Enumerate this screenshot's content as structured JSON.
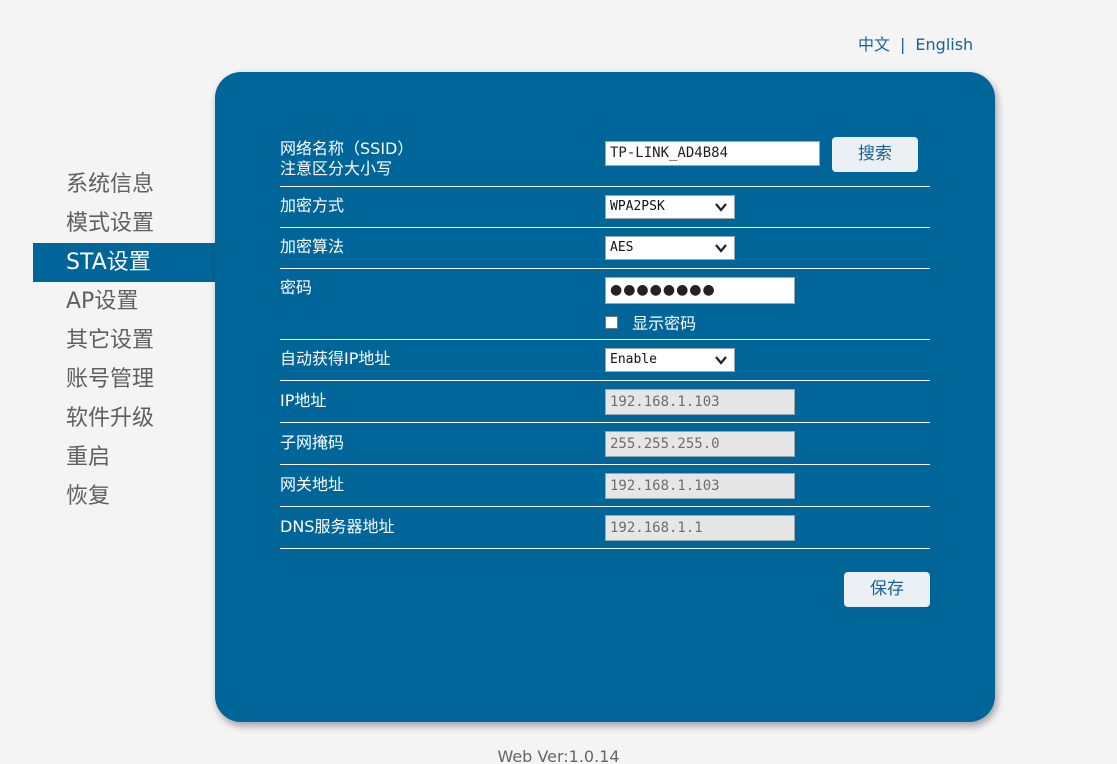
{
  "lang": {
    "zh": "中文",
    "sep": "|",
    "en": "English"
  },
  "sidebar": {
    "items": [
      {
        "label": "系统信息"
      },
      {
        "label": "模式设置"
      },
      {
        "label": "STA设置",
        "active": true
      },
      {
        "label": "AP设置"
      },
      {
        "label": "其它设置"
      },
      {
        "label": "账号管理"
      },
      {
        "label": "软件升级"
      },
      {
        "label": "重启"
      },
      {
        "label": "恢复"
      }
    ]
  },
  "form": {
    "ssid": {
      "label_line1": "网络名称（SSID）",
      "label_line2": "注意区分大小写",
      "value": "TP-LINK_AD4B84",
      "search_button": "搜索"
    },
    "encryption": {
      "label": "加密方式",
      "value": "WPA2PSK"
    },
    "algorithm": {
      "label": "加密算法",
      "value": "AES"
    },
    "password": {
      "label": "密码",
      "value": "●●●●●●●●",
      "show_label": "显示密码"
    },
    "dhcp": {
      "label": "自动获得IP地址",
      "value": "Enable"
    },
    "ip": {
      "label": "IP地址",
      "value": "192.168.1.103"
    },
    "mask": {
      "label": "子网掩码",
      "value": "255.255.255.0"
    },
    "gateway": {
      "label": "网关地址",
      "value": "192.168.1.103"
    },
    "dns": {
      "label": "DNS服务器地址",
      "value": "192.168.1.1"
    },
    "save_button": "保存"
  },
  "footer": {
    "version": "Web Ver:1.0.14"
  },
  "colors": {
    "panel": "#006699",
    "accent_text": "#1a6497",
    "background": "#f4f4f4"
  }
}
